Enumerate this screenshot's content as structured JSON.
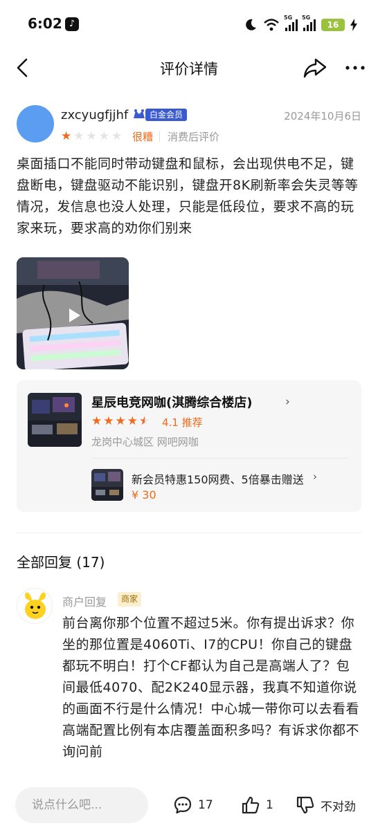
{
  "status_bar": {
    "time": "6:02",
    "signal1_tag": "5G",
    "signal2_tag": "5G",
    "battery": "16"
  },
  "header": {
    "title": "评价详情"
  },
  "review": {
    "username": "zxcyugfjjhf",
    "member_badge": "白金会员",
    "date": "2024年10月6日",
    "stars_filled": 1,
    "stars_total": 5,
    "rating_word": "很糟",
    "rating_note": "消费后评价",
    "text": "桌面插口不能同时带动键盘和鼠标，会出现供电不足，键盘断电，键盘驱动不能识别，键盘开8K刷新率会失灵等等情况，发信息也没人处理，只能是低段位，要求不高的玩家来玩，要求高的劝你们别来"
  },
  "shop": {
    "name": "星辰电竞网咖(淇腾综合楼店)",
    "score": "4.1 推荐",
    "rating": 4.5,
    "location": "龙岗中心城区 网吧网咖",
    "deal_title": "新会员特惠150网费、5倍暴击赠送",
    "deal_price": "¥ 30"
  },
  "replies": {
    "title": "全部回复 (17)",
    "items": [
      {
        "label": "商户回复",
        "tag": "商家",
        "text": "前台离你那个位置不超过5米。你有提出诉求？你坐的那位置是4060Ti、I7的CPU！你自己的键盘都玩不明白！打个CF都认为自己是高端人了？包间最低4070、配2K240显示器，我真不知道你说的画面不行是什么情况！中心城一带你可以去看看高端配置比例有本店覆盖面积多吗？有诉求你都不询问前"
      }
    ]
  },
  "bottom_bar": {
    "input_placeholder": "说点什么吧...",
    "comments_count": "17",
    "likes_count": "1",
    "dislike_label": "不对劲"
  },
  "colors": {
    "accent": "#f26a1b",
    "badge_blue": "#3a5bd0",
    "avatar_blue": "#5b9df0"
  }
}
